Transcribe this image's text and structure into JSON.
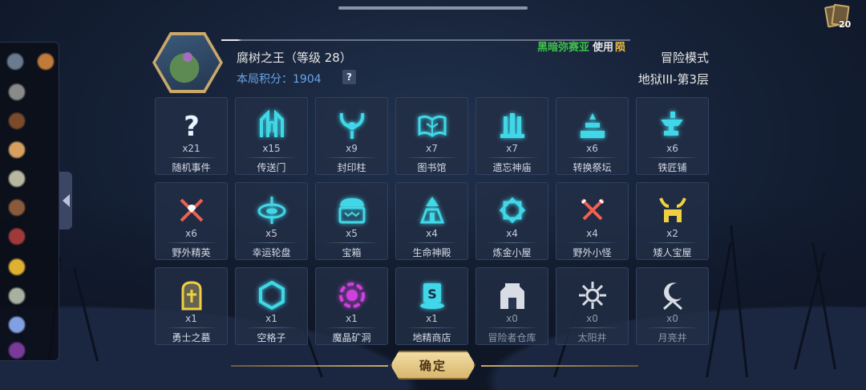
{
  "deck": {
    "icon": "card-deck-icon",
    "count": "20"
  },
  "boss": {
    "name": "腐树之王（等级 28）",
    "score_label": "本局积分：",
    "score_value": "1904",
    "help": "?",
    "owner_name": "黑暗弥赛亚",
    "owner_use": "使用",
    "owner_tail": "陨"
  },
  "mode": "冒险模式",
  "level": "地狱III-第3层",
  "sidebar_items": [
    {
      "icon": "stone-relic-icon"
    },
    {
      "icon": "scroll-map-icon"
    },
    {
      "icon": "pliers-icon"
    },
    {
      "icon": "potion-bag-icon"
    },
    {
      "icon": "bone-staff-icon"
    },
    {
      "icon": "stone-idol-icon"
    },
    {
      "icon": "mask-icon"
    },
    {
      "icon": "spell-book-icon"
    },
    {
      "icon": "gold-bars-icon"
    },
    {
      "icon": "rune-tablet-icon"
    },
    {
      "icon": "flower-icon"
    },
    {
      "icon": "witch-hat-icon"
    }
  ],
  "locations": [
    {
      "label": "随机事件",
      "count": "x21",
      "icon": "question-mark-icon",
      "color": "#e8f4ff"
    },
    {
      "label": "传送门",
      "count": "x15",
      "icon": "portal-icon",
      "color": "#40d8e8"
    },
    {
      "label": "封印柱",
      "count": "x9",
      "icon": "seal-pillar-icon",
      "color": "#40d8e8"
    },
    {
      "label": "图书馆",
      "count": "x7",
      "icon": "book-icon",
      "color": "#40d8e8"
    },
    {
      "label": "遗忘神庙",
      "count": "x7",
      "icon": "temple-icon",
      "color": "#40d8e8"
    },
    {
      "label": "转换祭坛",
      "count": "x6",
      "icon": "altar-icon",
      "color": "#40d8e8"
    },
    {
      "label": "铁匠铺",
      "count": "x6",
      "icon": "anvil-icon",
      "color": "#40d8e8"
    },
    {
      "label": "野外精英",
      "count": "x6",
      "icon": "elite-swords-icon",
      "color": "#f06050"
    },
    {
      "label": "幸运轮盘",
      "count": "x5",
      "icon": "roulette-icon",
      "color": "#40d8e8"
    },
    {
      "label": "宝箱",
      "count": "x5",
      "icon": "chest-icon",
      "color": "#40d8e8"
    },
    {
      "label": "生命神殿",
      "count": "x4",
      "icon": "life-shrine-icon",
      "color": "#40d8e8"
    },
    {
      "label": "炼金小屋",
      "count": "x4",
      "icon": "alchemy-icon",
      "color": "#40d8e8"
    },
    {
      "label": "野外小怪",
      "count": "x4",
      "icon": "crossed-swords-icon",
      "color": "#f06050"
    },
    {
      "label": "矮人宝屋",
      "count": "x2",
      "icon": "dwarf-house-icon",
      "color": "#f0d040"
    },
    {
      "label": "勇士之墓",
      "count": "x1",
      "icon": "tomb-icon",
      "color": "#f0d040"
    },
    {
      "label": "空格子",
      "count": "x1",
      "icon": "hexagon-icon",
      "color": "#40d8e8"
    },
    {
      "label": "魔晶矿洞",
      "count": "x1",
      "icon": "crystal-mine-icon",
      "color": "#d040e0"
    },
    {
      "label": "地精商店",
      "count": "x1",
      "icon": "shop-icon",
      "color": "#40d8e8"
    },
    {
      "label": "冒险者仓库",
      "count": "x0",
      "icon": "warehouse-icon",
      "color": "#d8dce4"
    },
    {
      "label": "太阳井",
      "count": "x0",
      "icon": "sun-well-icon",
      "color": "#d8dce4"
    },
    {
      "label": "月亮井",
      "count": "x0",
      "icon": "moon-well-icon",
      "color": "#d8dce4"
    }
  ],
  "confirm_label": "确定"
}
